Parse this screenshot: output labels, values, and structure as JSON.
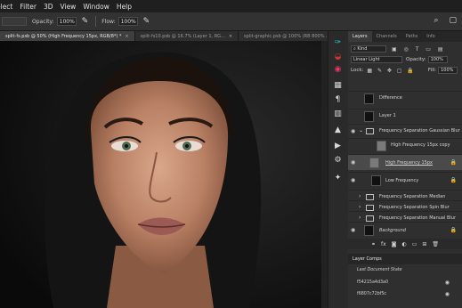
{
  "menu": [
    "elect",
    "Filter",
    "3D",
    "View",
    "Window",
    "Help"
  ],
  "options": {
    "opacity_label": "Opacity:",
    "opacity_value": "100%",
    "flow_label": "Flow:",
    "flow_value": "100%"
  },
  "tabs": [
    {
      "label": "split-fs.psb @ 50% (High Frequency 15px, RGB/8*) *",
      "close": "×",
      "active": true
    },
    {
      "label": "split-fs10.psb @ 16.7% (Layer 1, RG...",
      "close": "×",
      "active": false
    },
    {
      "label": "split-graphic.psb @ 100% (RB 800% ...",
      "close": "×",
      "active": false
    }
  ],
  "layers_panel": {
    "tabs": [
      "Layers",
      "Channels",
      "Paths",
      "Info"
    ],
    "filter_kind": "Kind",
    "blend_mode": "Linear Light",
    "opacity_label": "Opacity:",
    "opacity_value": "100%",
    "lock_label": "Lock:",
    "fill_label": "Fill:",
    "fill_value": "100%",
    "layers": [
      {
        "name": "Difference",
        "type": "image",
        "visible": false
      },
      {
        "name": "Layer 1",
        "type": "image",
        "visible": false
      },
      {
        "name": "Frequency Separation Gaussian Blur",
        "type": "folder",
        "visible": true
      },
      {
        "name": "High Frequency 15px copy",
        "type": "gray",
        "visible": false
      },
      {
        "name": "High Frequency 15px",
        "type": "gray",
        "visible": true,
        "selected": true
      },
      {
        "name": "Low Frequency",
        "type": "image",
        "visible": true
      },
      {
        "name": "Frequency Separation Median",
        "type": "folder",
        "visible": false
      },
      {
        "name": "Frequency Separation Spin Blur",
        "type": "folder",
        "visible": false
      },
      {
        "name": "Frequency Separation Manual Blur",
        "type": "folder",
        "visible": false
      },
      {
        "name": "Background",
        "type": "image",
        "visible": true
      }
    ]
  },
  "layer_comps": {
    "title": "Layer Comps",
    "items": [
      "Last Document State",
      "f54215a4d3a0",
      "f6807c72bf5c"
    ]
  }
}
